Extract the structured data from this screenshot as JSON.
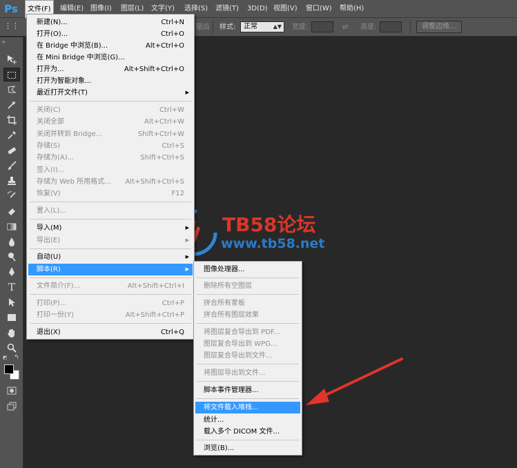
{
  "app": {
    "logo": "Ps"
  },
  "menubar": {
    "items": [
      {
        "label": "文件(F)"
      },
      {
        "label": "编辑(E)"
      },
      {
        "label": "图像(I)"
      },
      {
        "label": "图层(L)"
      },
      {
        "label": "文字(Y)"
      },
      {
        "label": "选择(S)"
      },
      {
        "label": "滤镜(T)"
      },
      {
        "label": "3D(D)"
      },
      {
        "label": "视图(V)"
      },
      {
        "label": "窗口(W)"
      },
      {
        "label": "帮助(H)"
      }
    ]
  },
  "options": {
    "partial_label": "锯齿",
    "style_label": "样式:",
    "style_value": "正常",
    "width_label": "宽度:",
    "height_label": "高度:",
    "refine_edge": "调整边缘..."
  },
  "file_menu": {
    "items": [
      {
        "label": "新建(N)...",
        "shortcut": "Ctrl+N"
      },
      {
        "label": "打开(O)...",
        "shortcut": "Ctrl+O"
      },
      {
        "label": "在 Bridge 中浏览(B)...",
        "shortcut": "Alt+Ctrl+O"
      },
      {
        "label": "在 Mini Bridge 中浏览(G)...",
        "shortcut": ""
      },
      {
        "label": "打开为...",
        "shortcut": "Alt+Shift+Ctrl+O"
      },
      {
        "label": "打开为智能对象...",
        "shortcut": ""
      },
      {
        "label": "最近打开文件(T)",
        "shortcut": "",
        "submenu": "▶"
      },
      {
        "label": "关闭(C)",
        "shortcut": "Ctrl+W"
      },
      {
        "label": "关闭全部",
        "shortcut": "Alt+Ctrl+W"
      },
      {
        "label": "关闭并转到 Bridge...",
        "shortcut": "Shift+Ctrl+W"
      },
      {
        "label": "存储(S)",
        "shortcut": "Ctrl+S"
      },
      {
        "label": "存储为(A)...",
        "shortcut": "Shift+Ctrl+S"
      },
      {
        "label": "签入(I)...",
        "shortcut": ""
      },
      {
        "label": "存储为 Web 所用格式...",
        "shortcut": "Alt+Shift+Ctrl+S"
      },
      {
        "label": "恢复(V)",
        "shortcut": "F12"
      },
      {
        "label": "置入(L)...",
        "shortcut": ""
      },
      {
        "label": "导入(M)",
        "shortcut": "",
        "submenu": "▶"
      },
      {
        "label": "导出(E)",
        "shortcut": "",
        "submenu": "▶"
      },
      {
        "label": "自动(U)",
        "shortcut": "",
        "submenu": "▶"
      },
      {
        "label": "脚本(R)",
        "shortcut": "",
        "submenu": "▶"
      },
      {
        "label": "文件简介(F)...",
        "shortcut": "Alt+Shift+Ctrl+I"
      },
      {
        "label": "打印(P)...",
        "shortcut": "Ctrl+P"
      },
      {
        "label": "打印一份(Y)",
        "shortcut": "Alt+Shift+Ctrl+P"
      },
      {
        "label": "退出(X)",
        "shortcut": "Ctrl+Q"
      }
    ]
  },
  "script_menu": {
    "items": [
      {
        "label": "图像处理器..."
      },
      {
        "label": "删除所有空图层"
      },
      {
        "label": "拼合所有蒙板"
      },
      {
        "label": "拼合所有图层效果"
      },
      {
        "label": "将图层复合导出到 PDF..."
      },
      {
        "label": "图层复合导出到 WPG..."
      },
      {
        "label": "图层复合导出到文件..."
      },
      {
        "label": "将图层导出到文件..."
      },
      {
        "label": "脚本事件管理器..."
      },
      {
        "label": "将文件载入堆栈..."
      },
      {
        "label": "统计..."
      },
      {
        "label": "载入多个 DICOM 文件..."
      },
      {
        "label": "浏览(B)..."
      }
    ]
  },
  "watermark": {
    "title": "TB58论坛",
    "url": "www.tb58.net"
  },
  "colors": {
    "highlight": "#3399ff",
    "arrow": "#e3342b",
    "workspace": "#282828"
  }
}
